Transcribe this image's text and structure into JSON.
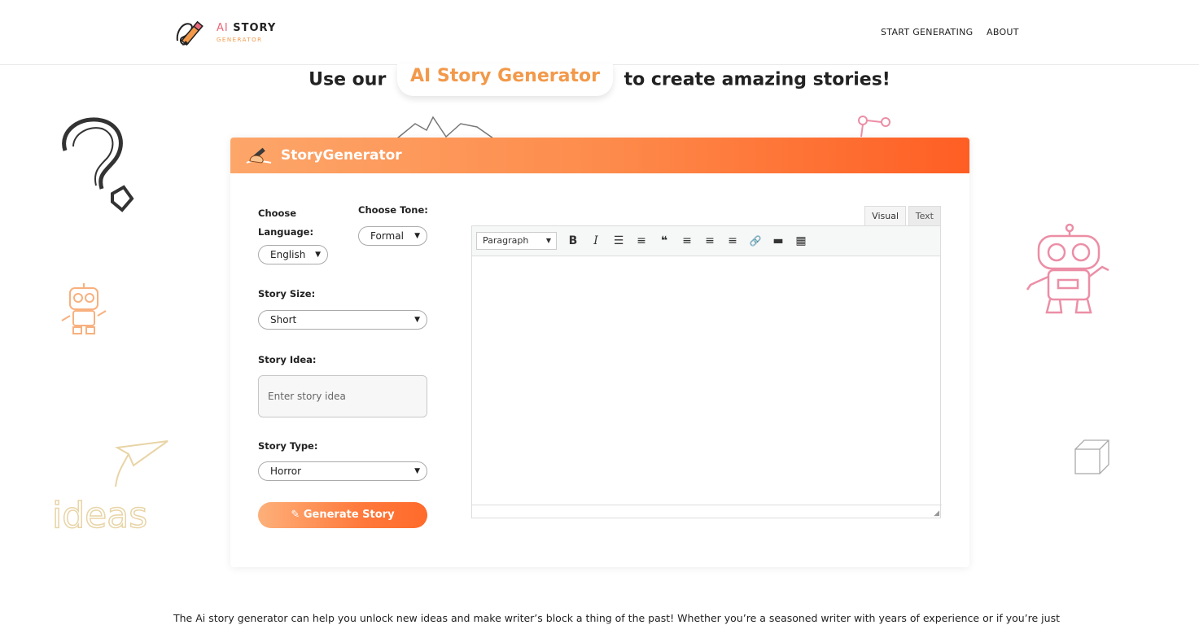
{
  "header": {
    "logo_ai": "AI",
    "logo_story": "STORY",
    "logo_sub": "GENERATOR",
    "nav": [
      {
        "label": "START GENERATING"
      },
      {
        "label": "ABOUT"
      }
    ]
  },
  "hero": {
    "prefix": "Use our",
    "highlight": "AI Story Generator",
    "suffix": "to create amazing stories!"
  },
  "card": {
    "title": "StoryGenerator",
    "language_label": "Choose Language:",
    "language_value": "English",
    "tone_label": "Choose Tone:",
    "tone_value": "Formal",
    "size_label": "Story Size:",
    "size_value": "Short",
    "idea_label": "Story Idea:",
    "idea_placeholder": "Enter story idea",
    "type_label": "Story Type:",
    "type_value": "Horror",
    "generate_label": "Generate Story"
  },
  "editor": {
    "tab_visual": "Visual",
    "tab_text": "Text",
    "format_value": "Paragraph",
    "tools": [
      {
        "name": "bold-icon",
        "glyph": "B"
      },
      {
        "name": "italic-icon",
        "glyph": "I"
      },
      {
        "name": "bullet-list-icon",
        "glyph": "☰"
      },
      {
        "name": "numbered-list-icon",
        "glyph": "≡"
      },
      {
        "name": "blockquote-icon",
        "glyph": "❝"
      },
      {
        "name": "align-left-icon",
        "glyph": "≡"
      },
      {
        "name": "align-center-icon",
        "glyph": "≡"
      },
      {
        "name": "align-right-icon",
        "glyph": "≡"
      },
      {
        "name": "link-icon",
        "glyph": "🔗"
      },
      {
        "name": "read-more-icon",
        "glyph": "▬"
      },
      {
        "name": "toolbar-toggle-icon",
        "glyph": "▦"
      }
    ]
  },
  "intro_text": "The Ai story generator can help you unlock new ideas and make writer’s block a thing of the past! Whether you’re a seasoned writer with years of experience or if you’re just",
  "colors": {
    "accent": "#f2994a",
    "gradient_start": "#fda66a",
    "gradient_end": "#ff5e23",
    "logo_pink": "#e9687a"
  }
}
